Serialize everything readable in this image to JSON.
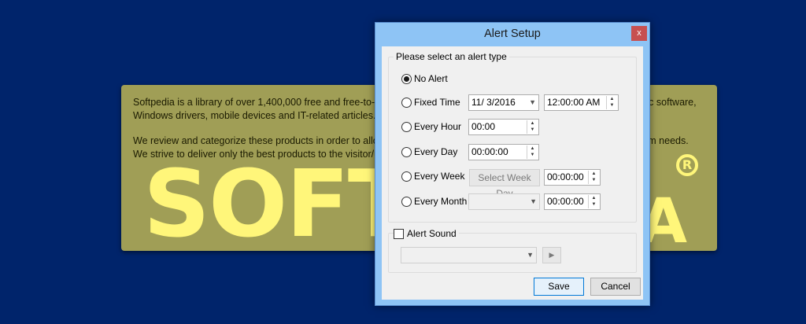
{
  "background_note": {
    "paragraph1": "Softpedia is a library of over 1,400,000 free and free-to-try software programs for Windows and Unix/Linux, games, Mac software, Windows drivers, mobile devices and IT-related articles.",
    "paragraph2_line1": "We review and categorize these products in order to allow the visitor/user to find the exact product they and their system needs.",
    "paragraph2_line2": "We strive to deliver only the best products to the visitor/user together with self-made evaluation and review notes.",
    "logo_left": "SOFT",
    "logo_right": "A",
    "registered_mark": "R"
  },
  "dialog": {
    "title": "Alert Setup",
    "close_label": "x",
    "alert_type_group": {
      "label": "Please select an alert type",
      "options": [
        {
          "label": "No Alert",
          "selected": true
        },
        {
          "label": "Fixed Time",
          "selected": false
        },
        {
          "label": "Every Hour",
          "selected": false
        },
        {
          "label": "Every Day",
          "selected": false
        },
        {
          "label": "Every Week",
          "selected": false
        },
        {
          "label": "Every Month",
          "selected": false
        }
      ],
      "fixed_time_date": "11/  3/2016",
      "fixed_time_time": "12:00:00 AM",
      "every_hour_value": "00:00",
      "every_day_value": "00:00:00",
      "every_week_day_button": "Select Week Day",
      "every_week_time": "00:00:00",
      "every_month_day": "",
      "every_month_time": "00:00:00"
    },
    "sound_group": {
      "checkbox_label": "Alert Sound",
      "checked": false,
      "sound_select_value": "",
      "play_icon": "▶"
    },
    "buttons": {
      "save": "Save",
      "cancel": "Cancel"
    }
  },
  "colors": {
    "desktop": "#00246b",
    "note_background": "#a09e56",
    "logo": "#fff67a",
    "title_bar": "#8ec4f5",
    "close_button": "#c75050"
  }
}
